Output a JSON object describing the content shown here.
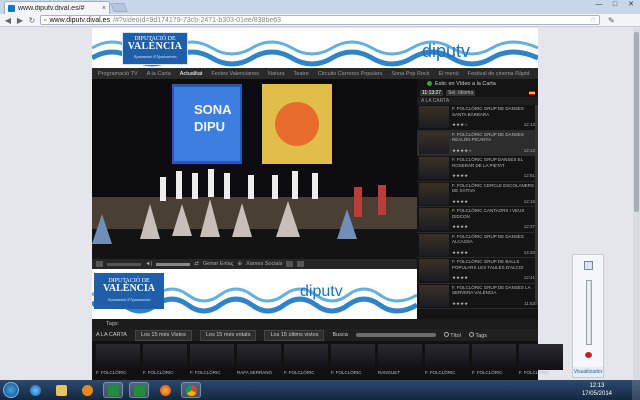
{
  "browser": {
    "tab_title": "www.diputv.dival.es/#",
    "tab_close": "×",
    "url_domain": "www.diputv.dival.es",
    "url_path": "/#?videoId=9d174179-73cb-2471-b303-01ee/838be63",
    "win_min": "—",
    "win_max": "□",
    "win_close": "✕"
  },
  "site": {
    "logo": {
      "line1": "DIPUTACIÓ DE",
      "line2": "VALÈNCIA",
      "line3": "Ajuntament d'Ajuntaments"
    },
    "brand": "diputv",
    "menu": [
      "Programació TV",
      "A la Carta",
      "Actualitat",
      "Festes Valencianes",
      "Natura",
      "Teatre",
      "Circuits Carreres Populars",
      "Sona Pop Rock",
      "El menú",
      "Festival de cinema Ràpid",
      "Cicle de Nadal"
    ],
    "menu_active": "Actualitat"
  },
  "stage": {
    "sign1": "SONA",
    "sign2": "DIPU"
  },
  "player": {
    "share": "Genar Enlaç",
    "social": "Xarxes Socials"
  },
  "sidebar": {
    "live_label": "Estic en Vídeo a la Carta",
    "time": "11:13:27",
    "lang": "Sel. Idioma",
    "section": "A LA CARTA",
    "items": [
      {
        "title": "F. FOLCLÒRIC GRUP DE DANSES SANTA BÀRBARA",
        "rating": "★★★☆",
        "dur": "12:13"
      },
      {
        "title": "F. FOLCLÒRIC GRUP DE DANSES REALÓN PICANYA",
        "rating": "★★★★☆",
        "dur": "12:13"
      },
      {
        "title": "F. FOLCLÒRIC GRUP DANSES EL ROSERAR DE LA PIETAT",
        "rating": "★★★★",
        "dur": "12:51"
      },
      {
        "title": "F. FOLCLÒRIC CERCLE ESCOLANERS DE XÀTIVA",
        "rating": "★★★★",
        "dur": "12:15"
      },
      {
        "title": "F. FOLCLÒRIC CANTAORS I VEUS DIDCON",
        "rating": "★★★★",
        "dur": "12:37"
      },
      {
        "title": "F. FOLCLÒRIC GRUP DE DANSES ALCASSA",
        "rating": "★★★★",
        "dur": "14:33"
      },
      {
        "title": "F. FOLCLÒRIC GRUP DE BALLS POPULARS LES TAULES D'ALCOI",
        "rating": "★★★★",
        "dur": "12:41"
      },
      {
        "title": "F. FOLCLÒRIC GRUP DE DANSES LA SERVERA VALÈNCIA",
        "rating": "★★★★",
        "dur": "11:53"
      },
      {
        "title": "F. FOLCLÒRIC GRUP DE DANSES",
        "rating": "",
        "dur": ""
      }
    ]
  },
  "tags_label": "Tags:",
  "filters": {
    "prefix": "A LA CARTA",
    "opt1": "Los 15 més Vistes",
    "opt2": "Los 15 més votats",
    "opt3": "Los 15 últims vistos",
    "search": "Busca",
    "r1": "Títol",
    "r2": "Tags"
  },
  "strip": [
    "F. FOLCLÒRIC",
    "F. FOLCLÒRIC",
    "F. FOLCLÒRIC",
    "RAFA SERRANO",
    "F. FOLCLÒRIC",
    "F. FOLCLÒRIC",
    "RANGUET",
    "F. FOLCLÒRIC",
    "F. FOLCLÒRIC",
    "F. FOLCLÒRIC"
  ],
  "gadget_caption": "Visualitzador",
  "taskbar": {
    "time": "12:13",
    "date": "17/05/2014"
  }
}
